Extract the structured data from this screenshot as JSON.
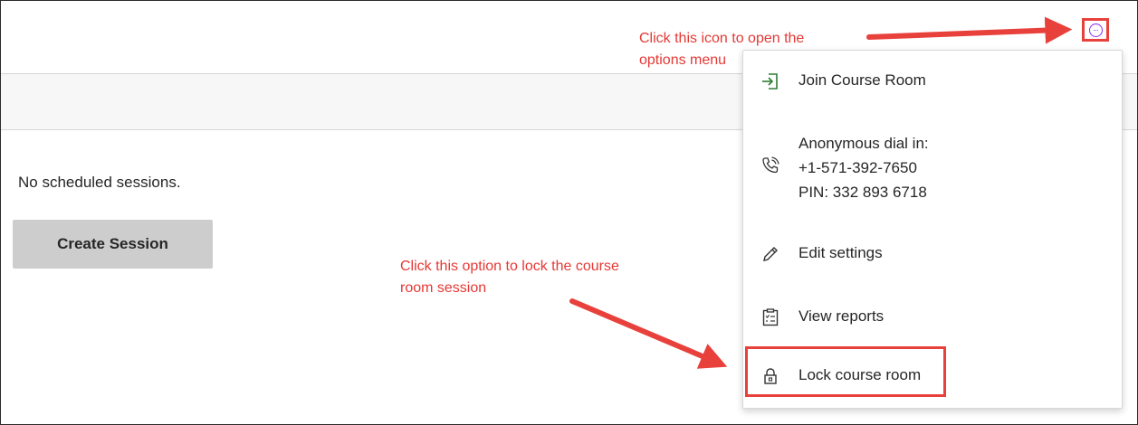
{
  "main": {
    "empty_text": "No scheduled sessions.",
    "create_label": "Create Session"
  },
  "annotations": {
    "top_line1": "Click this icon to open the",
    "top_line2": "options menu",
    "bottom_line1": "Click this option to lock the course",
    "bottom_line2": "room session"
  },
  "options_button": {
    "icon": "more-options-icon",
    "glyph": "···"
  },
  "menu": {
    "join_label": "Join Course Room",
    "dial_line1": "Anonymous dial in:",
    "dial_line2": "+1-571-392-7650",
    "dial_line3": "PIN: 332 893 6718",
    "edit_label": "Edit settings",
    "reports_label": "View reports",
    "lock_label": "Lock course room"
  },
  "colors": {
    "annotation": "#e53935",
    "highlight_border": "#e8413c",
    "options_icon": "#8a2be2",
    "join_icon": "#2e7d32"
  }
}
